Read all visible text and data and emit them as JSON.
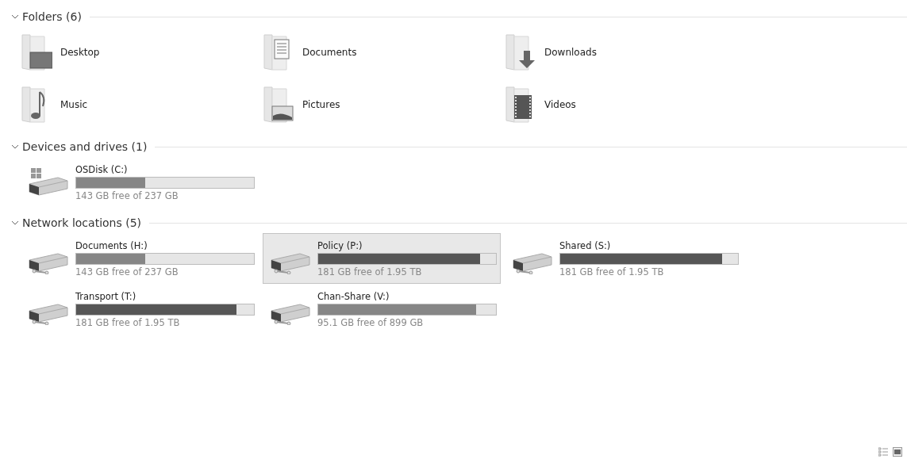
{
  "sections": [
    {
      "title": "Folders (6)",
      "expanded": true,
      "kind": "folders",
      "items": [
        {
          "name": "Desktop",
          "kind": "desktop"
        },
        {
          "name": "Documents",
          "kind": "documents"
        },
        {
          "name": "Downloads",
          "kind": "downloads"
        },
        {
          "name": "Music",
          "kind": "music"
        },
        {
          "name": "Pictures",
          "kind": "pictures"
        },
        {
          "name": "Videos",
          "kind": "videos"
        }
      ]
    },
    {
      "title": "Devices and drives (1)",
      "expanded": true,
      "kind": "drives",
      "items": [
        {
          "name": "OSDisk (C:)",
          "kind": "local",
          "level": 0.39,
          "low_space": false,
          "selected": false,
          "caption": "143 GB free of 237 GB"
        }
      ]
    },
    {
      "title": "Network locations (5)",
      "expanded": true,
      "kind": "drives",
      "items": [
        {
          "name": "Documents (H:)",
          "kind": "network",
          "level": 0.39,
          "low_space": false,
          "selected": false,
          "caption": "143 GB free of 237 GB"
        },
        {
          "name": "Policy (P:)",
          "kind": "network",
          "level": 0.91,
          "low_space": true,
          "selected": true,
          "caption": "181 GB free of 1.95 TB"
        },
        {
          "name": "Shared (S:)",
          "kind": "network",
          "level": 0.91,
          "low_space": true,
          "selected": false,
          "caption": "181 GB free of 1.95 TB"
        },
        {
          "name": "Transport (T:)",
          "kind": "network",
          "level": 0.9,
          "low_space": true,
          "selected": false,
          "caption": "181 GB free of 1.95 TB"
        },
        {
          "name": "Chan-Share (V:)",
          "kind": "network",
          "level": 0.89,
          "low_space": false,
          "selected": false,
          "caption": "95.1 GB free of 899 GB"
        }
      ]
    }
  ]
}
